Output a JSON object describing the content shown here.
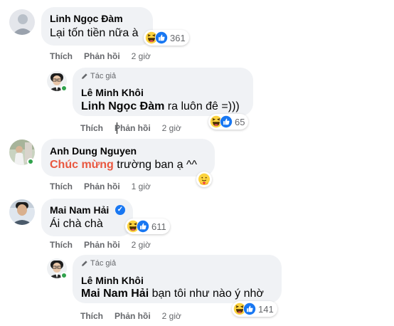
{
  "comments": [
    {
      "author": "Linh Ngọc Đàm",
      "text": "Lại tốn tiền nữa à",
      "reaction_count": "361",
      "actions": {
        "like": "Thích",
        "reply": "Phản hồi",
        "time": "2 giờ"
      }
    },
    {
      "author_tag": "Tác giả",
      "author": "Lê Minh Khôi",
      "mention": "Linh Ngọc Đàm",
      "text": " ra luôn đê =)))",
      "reaction_count": "65",
      "actions": {
        "like": "Thích",
        "reply": "Phản hồi",
        "time": "2 giờ"
      }
    },
    {
      "author": "Anh Dung Nguyen",
      "highlight": "Chúc mừng",
      "text": " trường ban ạ ^^",
      "actions": {
        "like": "Thích",
        "reply": "Phản hồi",
        "time": "1 giờ"
      }
    },
    {
      "author": "Mai Nam Hải",
      "text": "Ái chà chà",
      "reaction_count": "611",
      "actions": {
        "like": "Thích",
        "reply": "Phản hồi",
        "time": "2 giờ"
      }
    },
    {
      "author_tag": "Tác giả",
      "author": "Lê Minh Khôi",
      "mention": "Mai Nam Hải",
      "text": " bạn tôi như nào ý nhờ",
      "reaction_count": "141",
      "actions": {
        "like": "Thích",
        "reply": "Phản hồi",
        "time": "2 giờ"
      }
    }
  ],
  "colors": {
    "bubble": "#f0f2f5",
    "action_text": "#65676b",
    "highlight": "#e9573f",
    "verified": "#1877f2",
    "online": "#31a24c"
  },
  "icons": [
    "haha-reaction-icon",
    "like-reaction-icon",
    "care-reaction-icon",
    "verified-badge-icon",
    "pencil-icon"
  ]
}
